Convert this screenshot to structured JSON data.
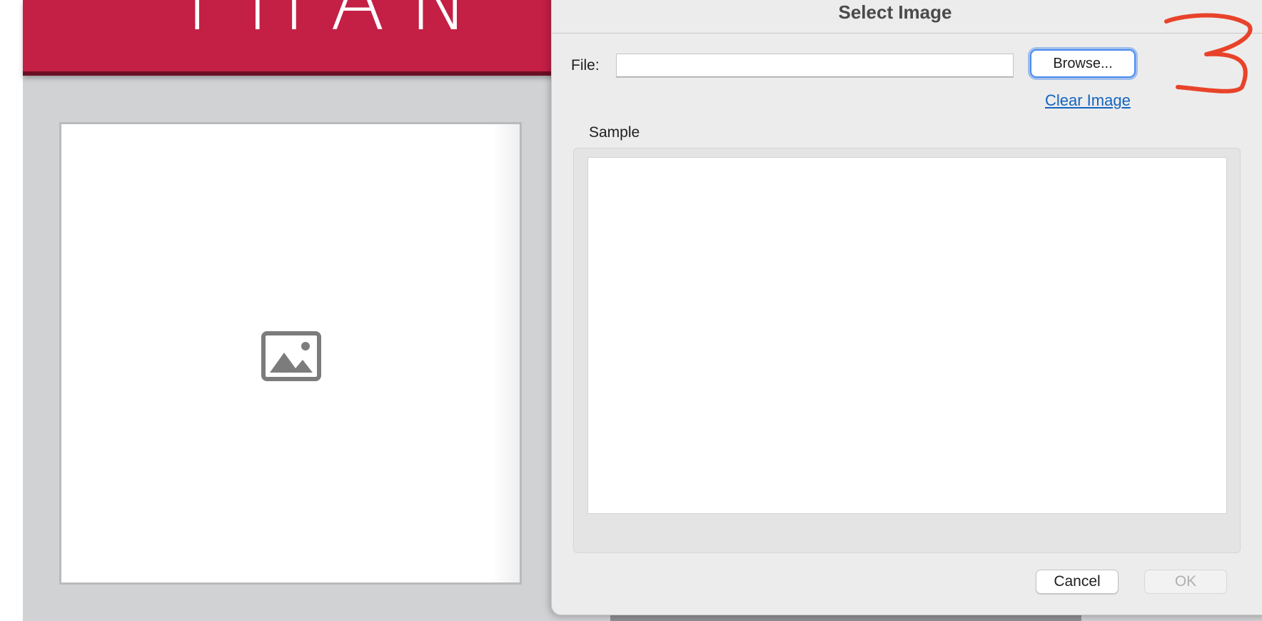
{
  "background_doc": {
    "banner_text": "THAN",
    "banner_color": "#c41f45",
    "placeholder_icon": "image-placeholder-icon"
  },
  "dialog": {
    "title": "Select Image",
    "file_label": "File:",
    "file_value": "",
    "file_placeholder": "",
    "browse_label": "Browse...",
    "clear_label": "Clear Image",
    "sample_label": "Sample",
    "cancel_label": "Cancel",
    "ok_label": "OK",
    "accent_color": "#4a8cf0",
    "link_color": "#1464c0"
  },
  "annotation": {
    "text": "3",
    "color": "#e8432a"
  }
}
